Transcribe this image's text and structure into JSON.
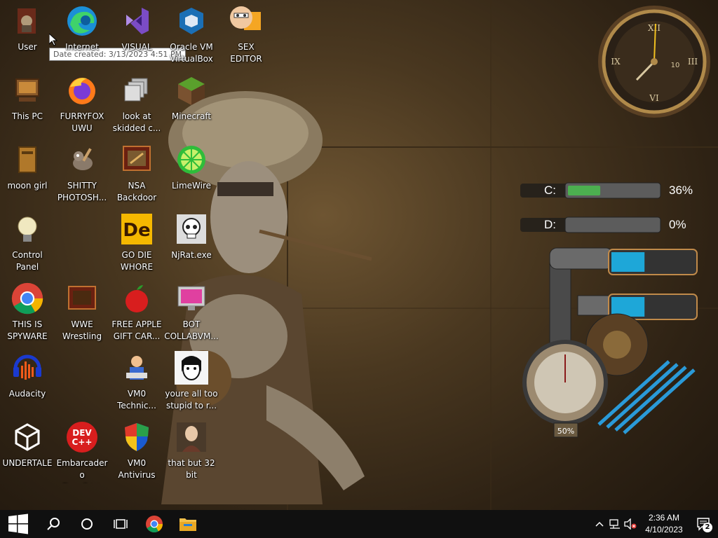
{
  "desktop": {
    "icons": [
      {
        "label": "User",
        "icon": "user-folder-icon"
      },
      {
        "label": "Internet",
        "icon": "edge-icon"
      },
      {
        "label": "VISUAL",
        "icon": "visual-studio-icon"
      },
      {
        "label": "Oracle VM\nVirtualBox",
        "icon": "virtualbox-icon"
      },
      {
        "label": "SEX\nEDITOR",
        "icon": "editor-icon"
      },
      {
        "label": "This PC",
        "icon": "computer-icon"
      },
      {
        "label": "FURRYFOX\nUWU",
        "icon": "firefox-icon"
      },
      {
        "label": "look at\nskidded c...",
        "icon": "files-icon"
      },
      {
        "label": "Minecraft",
        "icon": "minecraft-icon"
      },
      {
        "label": "moon girl",
        "icon": "book-icon"
      },
      {
        "label": "SHITTY\nPHOTOSH...",
        "icon": "gimp-icon"
      },
      {
        "label": "NSA\nBackdoor",
        "icon": "app-window-icon"
      },
      {
        "label": "LimeWire",
        "icon": "limewire-icon"
      },
      {
        "label": "Control Panel",
        "icon": "lightbulb-icon"
      },
      {
        "label": "GO DIE\nWHORE",
        "icon": "de-icon"
      },
      {
        "label": "NjRat.exe",
        "icon": "skull-icon"
      },
      {
        "label": "THIS IS\nSPYWARE",
        "icon": "chrome-icon"
      },
      {
        "label": "WWE\nWrestling",
        "icon": "tv-icon"
      },
      {
        "label": "FREE APPLE\nGIFT CAR...",
        "icon": "apple-icon"
      },
      {
        "label": "BOT\nCOLLABVM...",
        "icon": "monitor-icon"
      },
      {
        "label": "Audacity",
        "icon": "audacity-icon"
      },
      {
        "label": "VM0\nTechnic...",
        "icon": "technician-icon"
      },
      {
        "label": "youre all too\nstupid to r...",
        "icon": "portrait-icon"
      },
      {
        "label": "UNDERTALE",
        "icon": "unity-icon"
      },
      {
        "label": "Embarcadero\nDev-C++",
        "icon": "devcpp-icon"
      },
      {
        "label": "VM0\nAntivirus",
        "icon": "shield-icon"
      },
      {
        "label": "that but 32\nbit",
        "icon": "painting-icon"
      }
    ],
    "tooltip": "Date created: 3/13/2023 4:51 PM",
    "devcpp_text": "DEV\nC++",
    "de_text": "De"
  },
  "gadgets": {
    "drives": [
      {
        "label": "C:",
        "percent": 36,
        "percent_text": "36%"
      },
      {
        "label": "D:",
        "percent": 0,
        "percent_text": "0%"
      }
    ],
    "cpu_gauge_text": "50%",
    "meter_levels": [
      0.4,
      0.4
    ]
  },
  "taskbar": {
    "time": "2:36 AM",
    "date": "4/10/2023",
    "notifications_count": "2",
    "buttons": [
      "start-icon",
      "search-icon",
      "cortana-icon",
      "task-view-icon",
      "chrome-icon",
      "file-explorer-icon"
    ]
  },
  "colors": {
    "taskbar_bg": "#101010",
    "drive_bar": "#4caf50",
    "meter_blue": "#1ea7d8"
  }
}
